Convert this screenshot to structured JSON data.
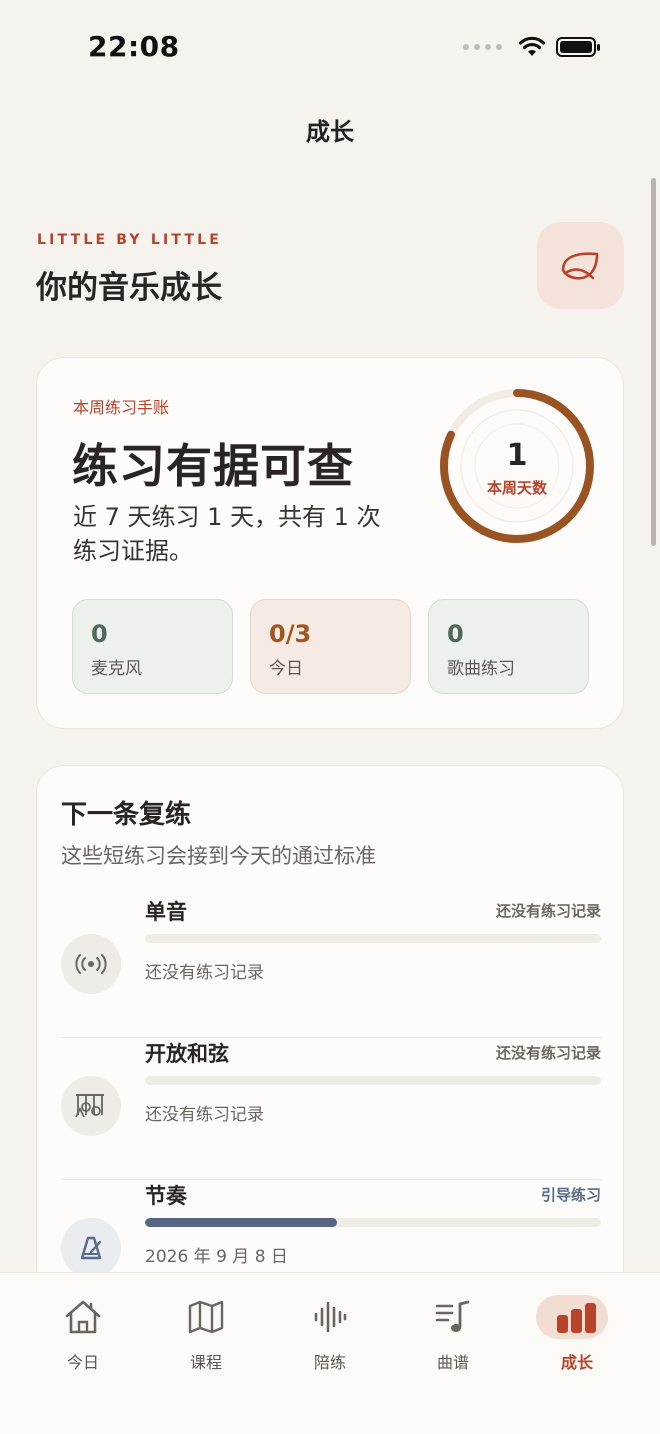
{
  "status_bar": {
    "time": "22:08"
  },
  "nav": {
    "title": "成长"
  },
  "header": {
    "eyebrow": "LITTLE BY LITTLE",
    "title": "你的音乐成长",
    "action_icon": "leaf-icon"
  },
  "summary": {
    "eyebrow": "本周练习手账",
    "headline": "练习有据可查",
    "description": "近 7 天练习 1 天，共有 1 次练习证据。",
    "ring": {
      "value": "1",
      "label": "本周天数",
      "progress": 0.82
    },
    "stats": [
      {
        "value": "0",
        "label": "麦克风",
        "tone": "green"
      },
      {
        "value": "0/3",
        "label": "今日",
        "tone": "orange"
      },
      {
        "value": "0",
        "label": "歌曲练习",
        "tone": "green"
      }
    ]
  },
  "review": {
    "title": "下一条复练",
    "subtitle": "这些短练习会接到今天的通过标准",
    "items": [
      {
        "name": "单音",
        "status": "还没有练习记录",
        "note": "还没有练习记录",
        "progress": 0,
        "icon": "signal-icon"
      },
      {
        "name": "开放和弦",
        "status": "还没有练习记录",
        "note": "还没有练习记录",
        "progress": 0,
        "icon": "guitar-icon"
      },
      {
        "name": "节奏",
        "status": "引导练习",
        "note": "2026 年 9 月 8 日",
        "progress": 0.42,
        "icon": "metronome-icon"
      }
    ]
  },
  "tabs": [
    {
      "label": "今日",
      "icon": "home-icon",
      "active": false
    },
    {
      "label": "课程",
      "icon": "map-icon",
      "active": false
    },
    {
      "label": "陪练",
      "icon": "waveform-icon",
      "active": false
    },
    {
      "label": "曲谱",
      "icon": "music-note-icon",
      "active": false
    },
    {
      "label": "成长",
      "icon": "bar-chart-icon",
      "active": true
    }
  ],
  "colors": {
    "accent": "#b8432b",
    "ring": "#9a5424",
    "rhythm_bar": "#566683",
    "background": "#f6f3ee"
  }
}
